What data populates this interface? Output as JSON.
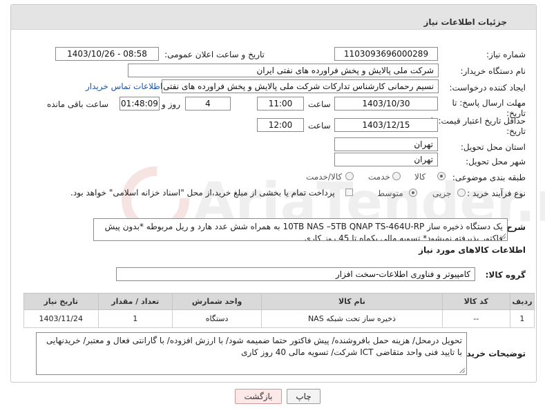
{
  "panel": {
    "title": "جزئیات اطلاعات نیاز"
  },
  "labels": {
    "need_number": "شماره نیاز:",
    "announce_datetime": "تاریخ و ساعت اعلان عمومی:",
    "buyer_org": "نام دستگاه خریدار:",
    "requester": "ایجاد کننده درخواست:",
    "send_deadline": "مهلت ارسال پاسخ: تا",
    "send_deadline_2": "تاریخ:",
    "price_validity": "حداقل تاریخ اعتبار قیمت: تا",
    "price_validity_2": "تاریخ:",
    "hour": "ساعت",
    "hour2": "ساعت",
    "day_and": "روز و",
    "remaining": "ساعت باقی مانده",
    "province": "استان محل تحویل:",
    "city": "شهر محل تحویل:",
    "category": "طبقه بندی موضوعی:",
    "process_type": "نوع فرآیند خرید :",
    "description": "شرح کلی نیاز:",
    "goods_info": "اطلاعات کالاهای مورد نیاز",
    "goods_group": "گروه کالا:",
    "buyer_notes": "توضیحات خریدار:"
  },
  "values": {
    "need_number": "1103093696000289",
    "announce_datetime": "1403/10/26 - 08:58",
    "buyer_org": "شرکت ملی پالایش و پخش فراورده های نفتی ایران",
    "requester": "نسیم رحمانی کارشناس تدارکات شرکت ملی پالایش و پخش فراورده های نفتی",
    "contact_link": "اطلاعات تماس خریدار",
    "send_date": "1403/10/30",
    "send_time": "11:00",
    "days": "4",
    "remaining_time": "01:48:09",
    "validity_date": "1403/12/15",
    "validity_time": "12:00",
    "province": "تهران",
    "city": "تهران"
  },
  "category_options": [
    "کالا",
    "خدمت",
    "کالا/خدمت"
  ],
  "category_selected": "کالا",
  "process_options": [
    "جزیی",
    "متوسط"
  ],
  "process_selected": "متوسط",
  "process_note": "پرداخت تمام یا بخشی از مبلغ خرید،از محل \"اسناد خزانه اسلامی\" خواهد بود.",
  "description_text": "یک دستگاه ذخیره ساز 10TB NAS –5TB QNAP TS-464U-RP به همراه شش عدد هارد و ریل مربوطه *بدون پیش فاکتور پذیرفته نمیشود* تسویه مالی یکماه تا 45 روز کاری",
  "goods_group_value": "کامپیوتر و فناوری اطلاعات-سخت افزار",
  "table": {
    "headers": [
      "ردیف",
      "کد کالا",
      "نام کالا",
      "واحد شمارش",
      "تعداد / مقدار",
      "تاریخ نیاز"
    ],
    "rows": [
      [
        "1",
        "--",
        "ذخیره ساز تحت شبکه NAS",
        "دستگاه",
        "1",
        "1403/11/24"
      ]
    ]
  },
  "buyer_notes_text": "تحویل درمحل/ هزینه حمل بافروشنده/ پیش فاکتور حتما ضمیمه شود/ با ارزش افزوده/ با گارانتی فعال و معتبر/ خریدنهایی با تایید فنی واحد متقاضی ICT شرکت/ تسویه مالی 40 روز کاری",
  "buttons": {
    "print": "چاپ",
    "back": "بازگشت"
  },
  "watermark_text": "AriaTender.neT",
  "colors": {
    "link": "#1a55b0",
    "header_bg": "#e4e4e4",
    "back_bg": "#fde8e8"
  }
}
